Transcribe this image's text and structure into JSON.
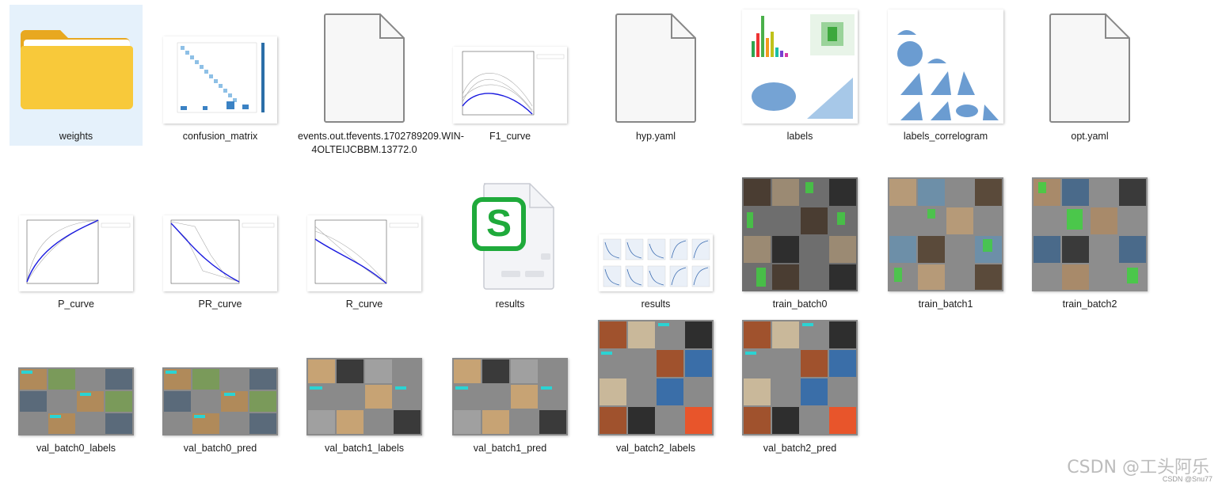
{
  "files": {
    "weights": "weights",
    "confusion_matrix": "confusion_matrix",
    "events": "events.out.tfevents.1702789209.WIN-4OLTEIJCBBM.13772.0",
    "f1_curve": "F1_curve",
    "hyp": "hyp.yaml",
    "labels": "labels",
    "labels_correlogram": "labels_correlogram",
    "opt": "opt.yaml",
    "p_curve": "P_curve",
    "pr_curve": "PR_curve",
    "r_curve": "R_curve",
    "results_csv": "results",
    "results_png": "results",
    "train_batch0": "train_batch0",
    "train_batch1": "train_batch1",
    "train_batch2": "train_batch2",
    "val_batch0_labels": "val_batch0_labels",
    "val_batch0_pred": "val_batch0_pred",
    "val_batch1_labels": "val_batch1_labels",
    "val_batch1_pred": "val_batch1_pred",
    "val_batch2_labels": "val_batch2_labels",
    "val_batch2_pred": "val_batch2_pred"
  },
  "watermark": "CSDN @工头阿乐",
  "watermark_small": "CSDN @Snu77",
  "colors": {
    "selected_bg": "#e5f1fb",
    "folder_yellow": "#f8c93a",
    "spreadsheet_green": "#1faa3b"
  }
}
